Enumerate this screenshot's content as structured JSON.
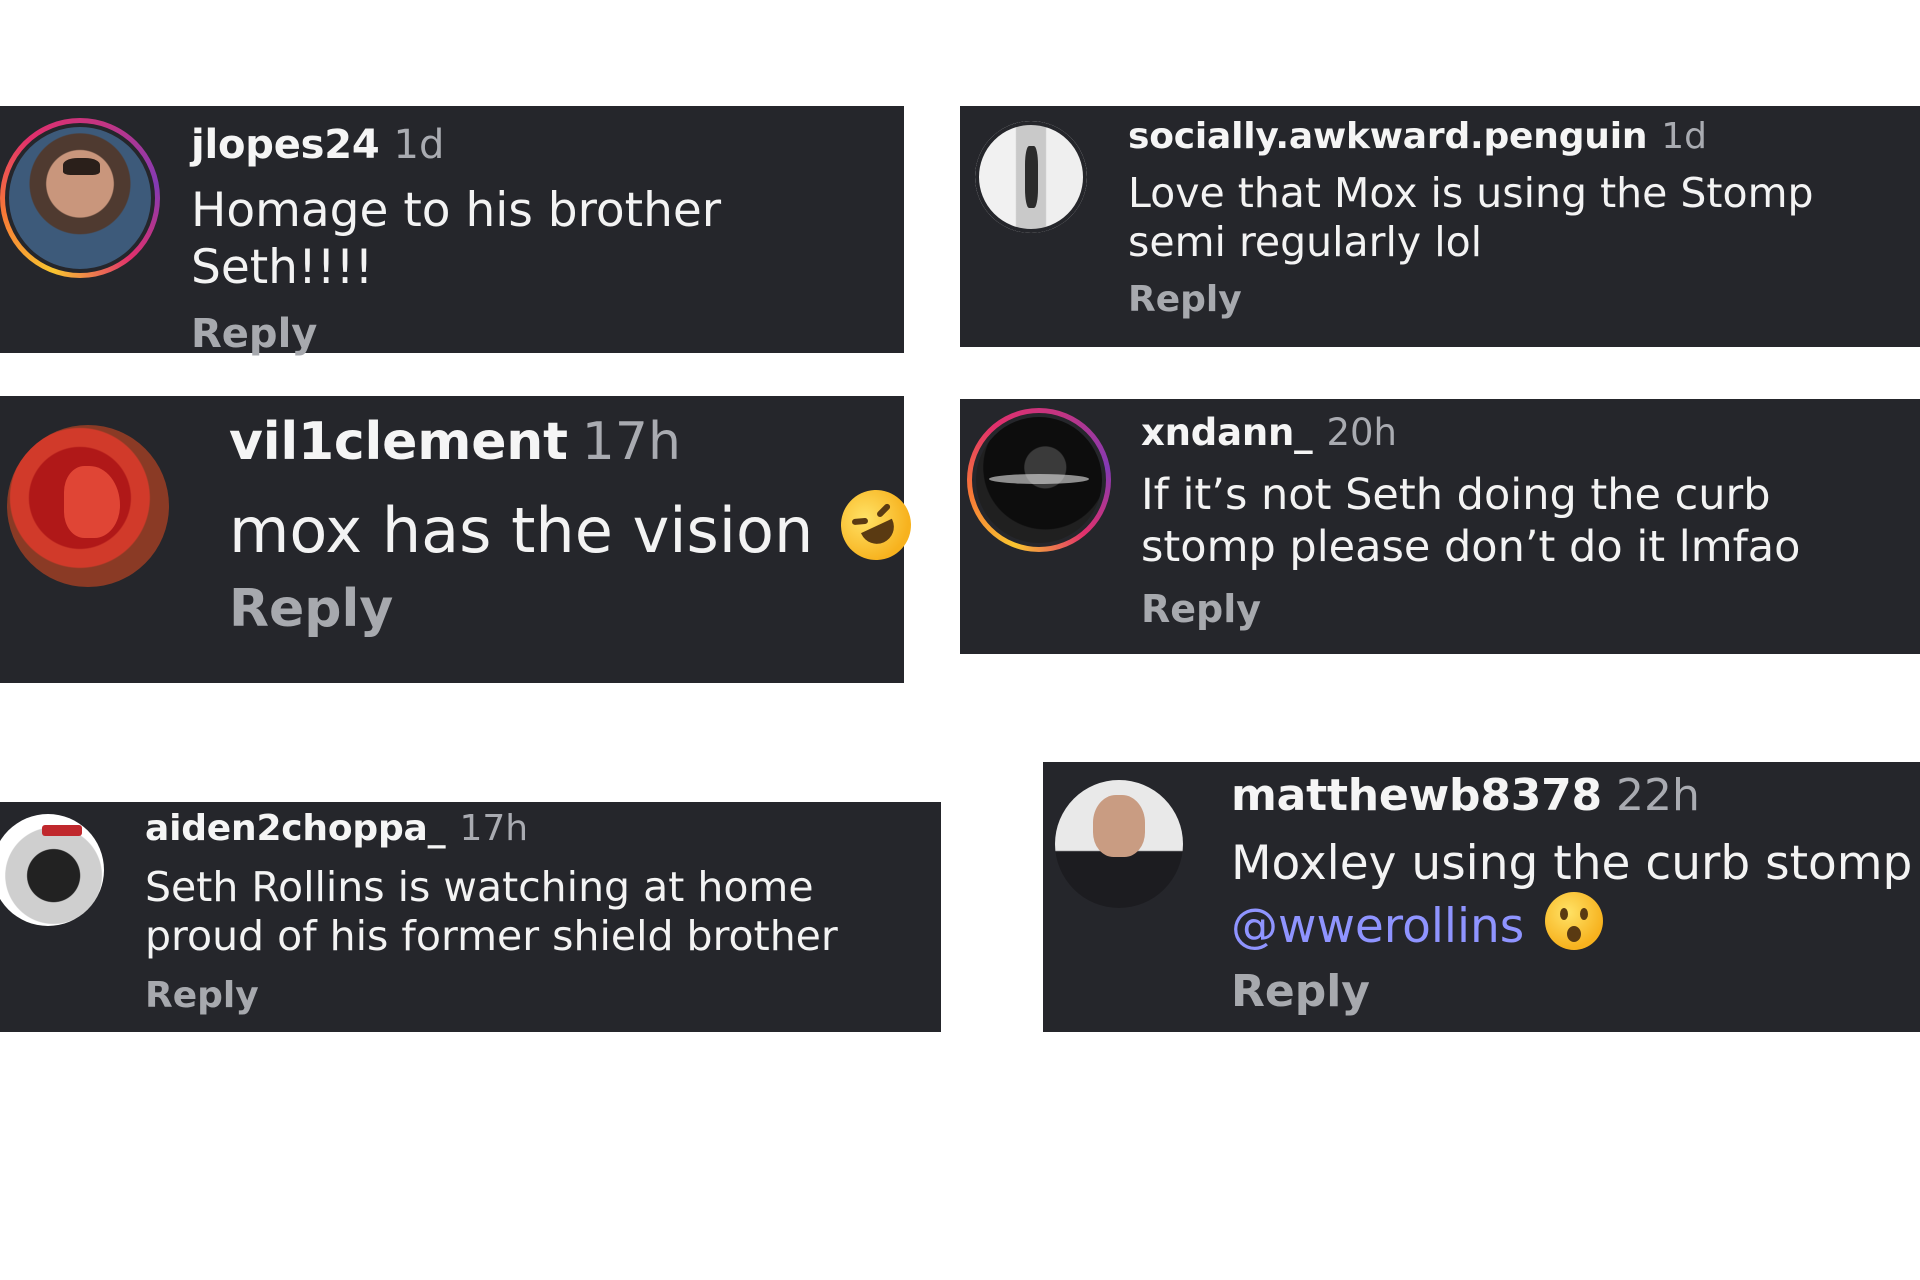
{
  "comments": [
    {
      "username": "jlopes24",
      "time": "1d",
      "text": "Homage to his brother Seth!!!!",
      "reply_label": "Reply",
      "avatar_icon": "user-photo-avatar",
      "story_ring": true
    },
    {
      "username": "socially.awkward.penguin",
      "time": "1d",
      "text": "Love that Mox is using the Stomp semi regularly lol",
      "reply_label": "Reply",
      "avatar_icon": "user-photo-avatar",
      "story_ring": false
    },
    {
      "username": "vil1clement",
      "time": "17h",
      "text": "mox has the vision",
      "emoji": "rolling-on-floor-laughing-emoji",
      "reply_label": "Reply",
      "avatar_icon": "artwork-avatar",
      "story_ring": false
    },
    {
      "username": "xndann_",
      "time": "20h",
      "text": "If it’s not Seth doing the curb stomp please don’t do it lmfao",
      "reply_label": "Reply",
      "avatar_icon": "user-photo-avatar",
      "story_ring": true
    },
    {
      "username": "aiden2choppa_",
      "time": "17h",
      "text": "Seth Rollins is watching at home proud of his former shield brother",
      "reply_label": "Reply",
      "avatar_icon": "user-photo-avatar",
      "story_ring": false
    },
    {
      "username": "matthewb8378",
      "time": "22h",
      "text": "Moxley using the curb stomp",
      "mention": "@wwerollins",
      "emoji": "surprised-face-emoji",
      "reply_label": "Reply",
      "avatar_icon": "user-photo-avatar",
      "story_ring": false
    }
  ],
  "colors": {
    "card_background": "#25262b",
    "mention": "#8f94ff",
    "secondary_text": "#a7a9ae"
  }
}
